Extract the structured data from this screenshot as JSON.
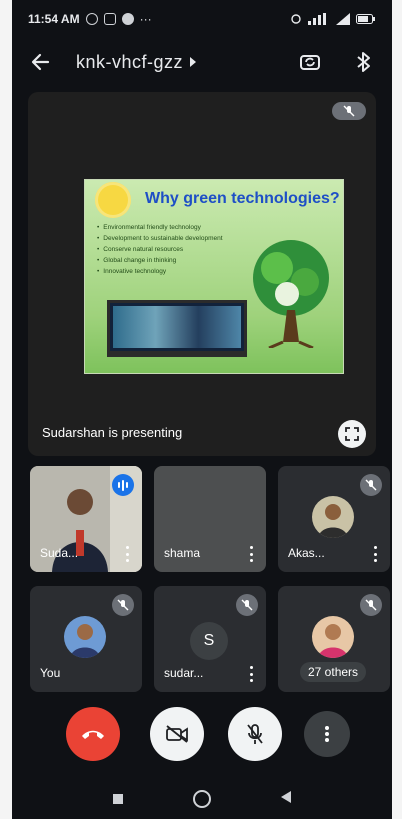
{
  "status_bar": {
    "time": "11:54 AM",
    "overflow": "···"
  },
  "header": {
    "meeting_code": "knk-vhcf-gzz"
  },
  "stage": {
    "slide": {
      "title": "Why green technologies?",
      "bullets": [
        "Environmental friendly technology",
        "Development to sustainable development",
        "Conserve natural resources",
        "Global change in thinking",
        "Innovative technology"
      ]
    },
    "caption": "Sudarshan is presenting"
  },
  "participants": [
    {
      "name": "Suda...",
      "state": "speaking"
    },
    {
      "name": "shama",
      "state": "camera-off"
    },
    {
      "name": "Akas...",
      "state": "muted"
    },
    {
      "name": "You",
      "state": "muted"
    },
    {
      "name": "sudar...",
      "state": "muted",
      "initial": "S"
    },
    {
      "name": "",
      "others_label": "27 others",
      "state": "muted"
    }
  ],
  "colors": {
    "end_call": "#ea4335",
    "speaking": "#1a73e8",
    "background": "#0f1115"
  }
}
